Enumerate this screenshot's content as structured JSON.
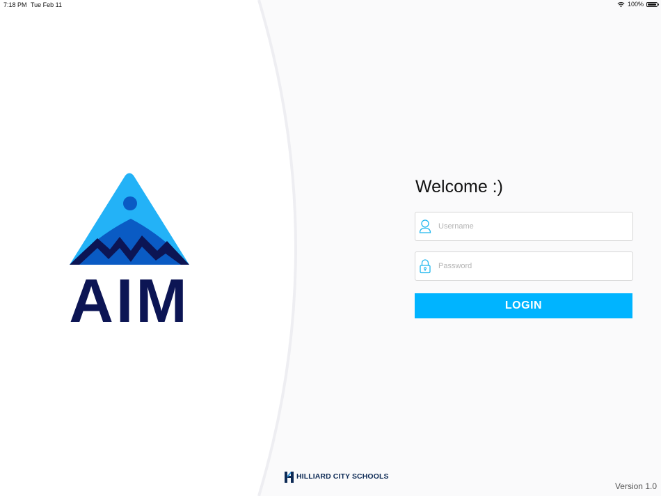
{
  "status_bar": {
    "time": "7:18 PM",
    "date": "Tue Feb 11",
    "battery": "100%",
    "battery_level": 1.0
  },
  "brand": {
    "logo_text": "AIM",
    "colors": {
      "light_blue": "#23b2f7",
      "mid_blue": "#0a5bc4",
      "navy": "#0c1554"
    }
  },
  "login": {
    "welcome": "Welcome :)",
    "username_placeholder": "Username",
    "password_placeholder": "Password",
    "button_label": "LOGIN",
    "accent": "#00b4ff"
  },
  "footer": {
    "school": "HILLIARD CITY SCHOOLS",
    "version": "Version 1.0"
  }
}
